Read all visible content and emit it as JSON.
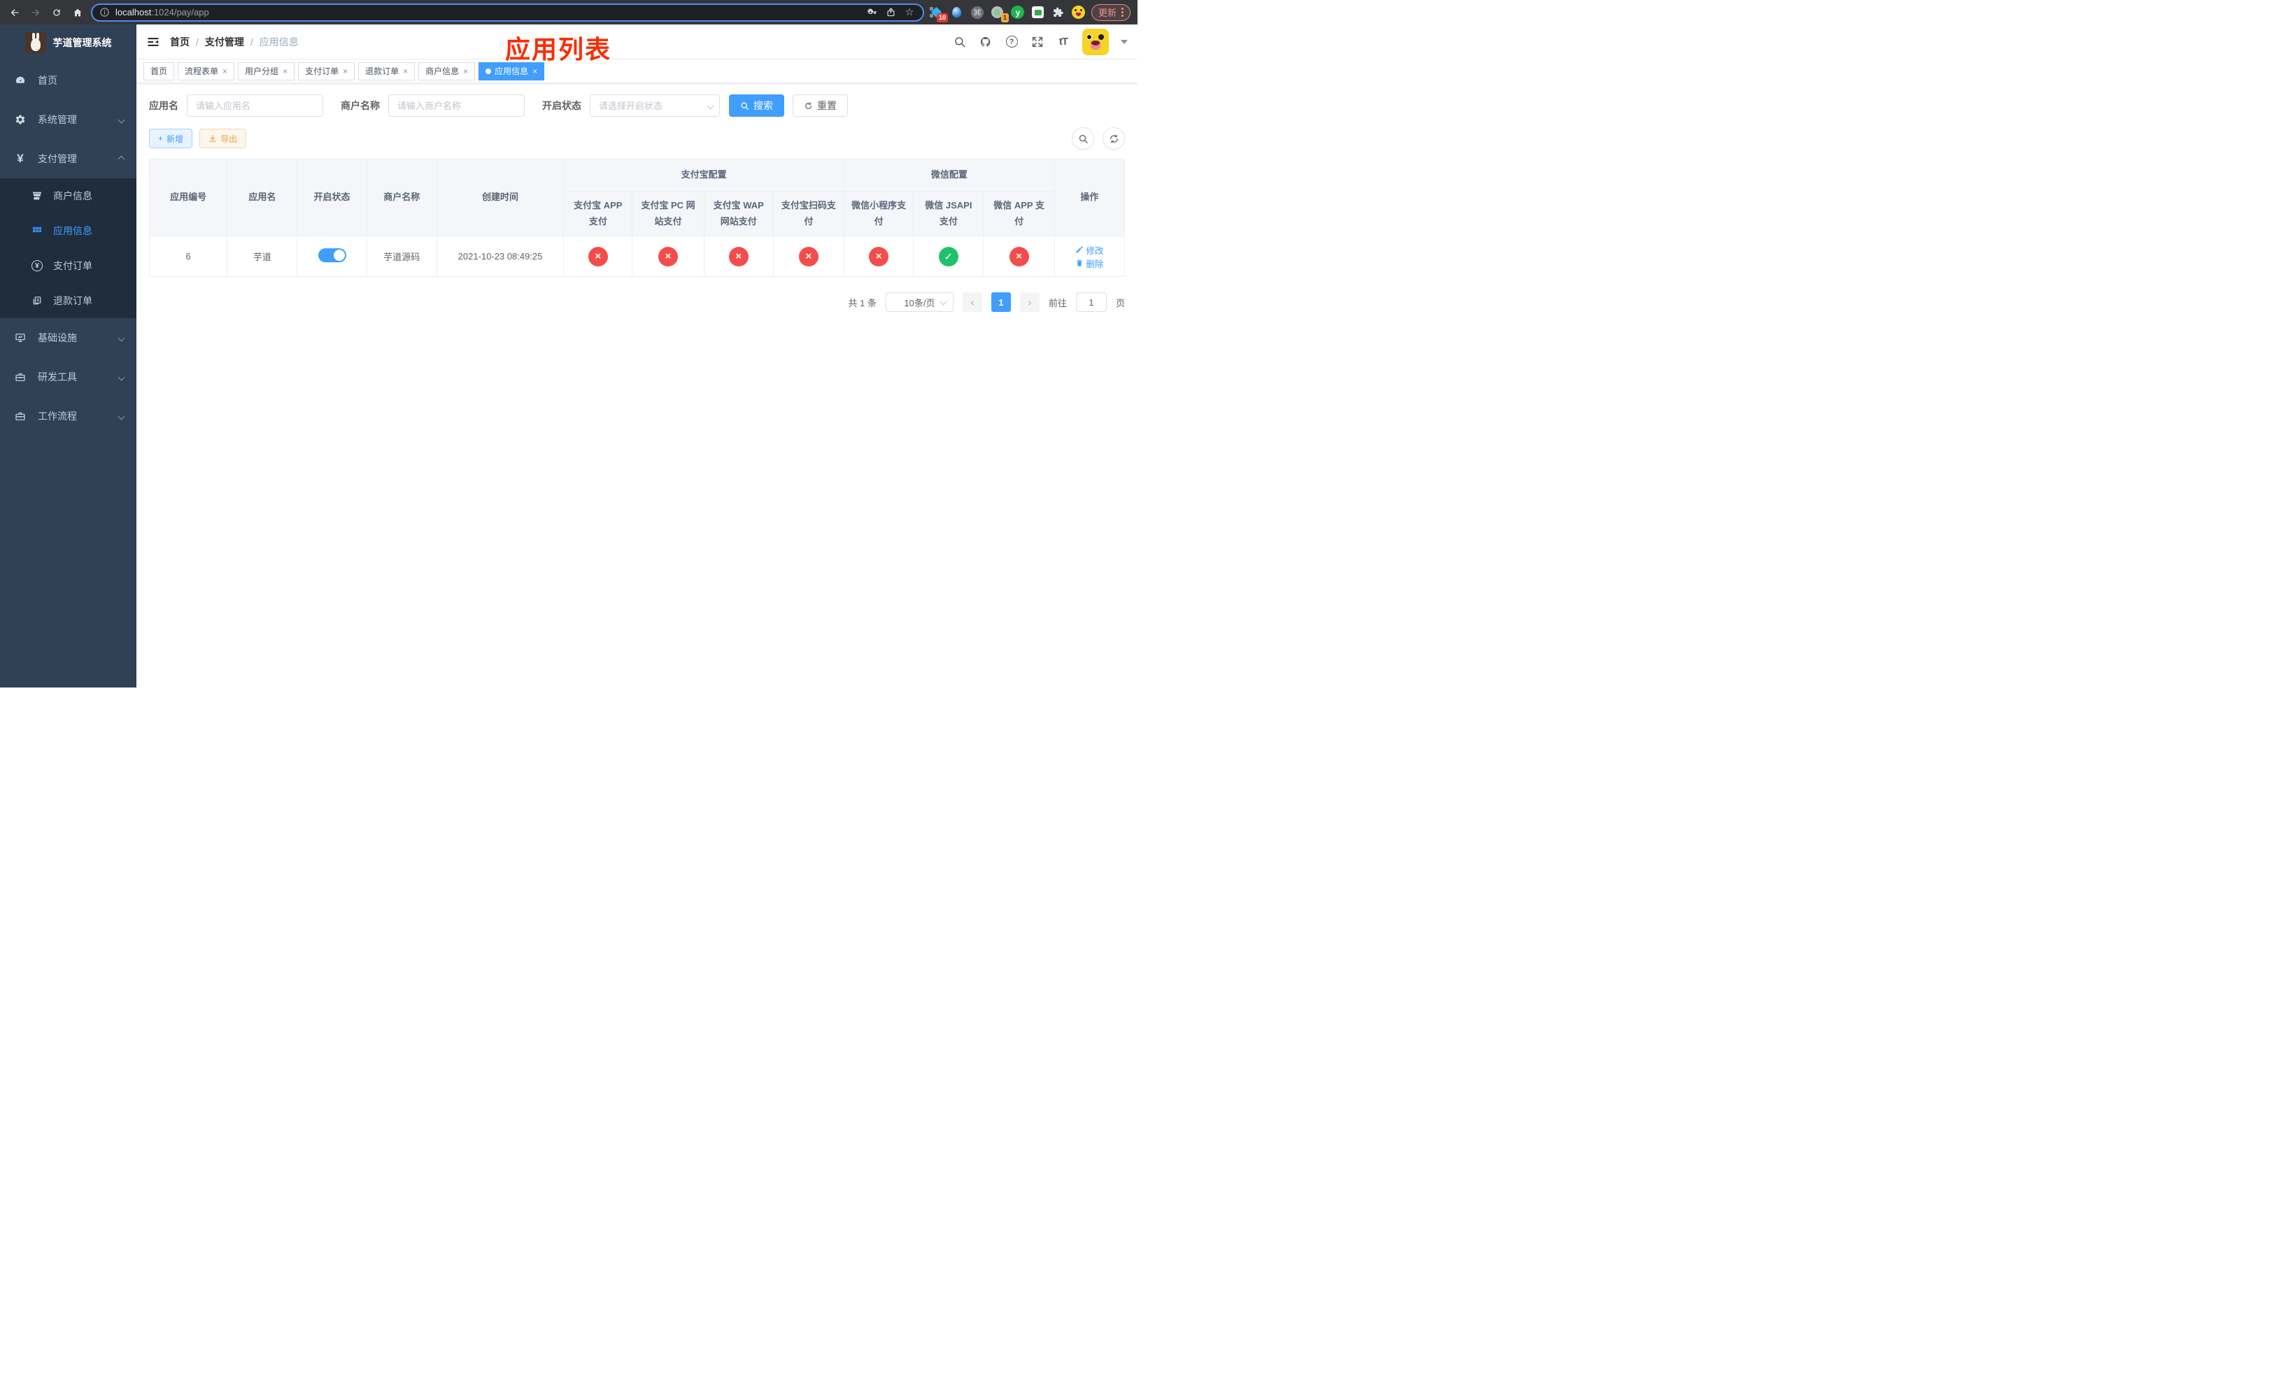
{
  "browser": {
    "url": {
      "host": "localhost",
      "rest": ":1024/pay/app"
    },
    "update_button": "更新",
    "extensions": {
      "diamond_badge": "10",
      "target_badge": "1",
      "y_label": "y"
    }
  },
  "glyphs": {
    "close": "×",
    "plus": "+",
    "star": "☆",
    "command": "⌘",
    "help": "?",
    "font_size": "tT",
    "yen": "¥",
    "prev": "‹",
    "next": "›"
  },
  "sidebar": {
    "title": "芋道管理系统",
    "menu": [
      {
        "label": "首页"
      },
      {
        "label": "系统管理"
      },
      {
        "label": "支付管理"
      }
    ],
    "submenu": [
      {
        "label": "商户信息"
      },
      {
        "label": "应用信息"
      },
      {
        "label": "支付订单"
      },
      {
        "label": "退款订单"
      }
    ],
    "menu2": [
      {
        "label": "基础设施"
      },
      {
        "label": "研发工具"
      },
      {
        "label": "工作流程"
      }
    ]
  },
  "navbar": {
    "breadcrumb": [
      "首页",
      "支付管理",
      "应用信息"
    ],
    "separator": "/"
  },
  "annotation": {
    "title": "应用列表"
  },
  "tabs": [
    {
      "label": "首页"
    },
    {
      "label": "流程表单"
    },
    {
      "label": "用户分组"
    },
    {
      "label": "支付订单"
    },
    {
      "label": "退款订单"
    },
    {
      "label": "商户信息"
    },
    {
      "label": "应用信息"
    }
  ],
  "filters": {
    "app_name_label": "应用名",
    "app_name_placeholder": "请输入应用名",
    "merchant_label": "商户名称",
    "merchant_placeholder": "请输入商户名称",
    "status_label": "开启状态",
    "status_placeholder": "请选择开启状态",
    "search_label": "搜索",
    "reset_label": "重置"
  },
  "toolbar": {
    "add_label": "新增",
    "export_label": "导出"
  },
  "table": {
    "headers": {
      "app_id": "应用编号",
      "app_name": "应用名",
      "status": "开启状态",
      "merchant": "商户名称",
      "created": "创建时间",
      "alipay_group": "支付宝配置",
      "wechat_group": "微信配置",
      "actions": "操作",
      "alipay_cols": [
        "支付宝 APP 支付",
        "支付宝 PC 网站支付",
        "支付宝 WAP 网站支付",
        "支付宝扫码支付"
      ],
      "wechat_cols": [
        "微信小程序支付",
        "微信 JSAPI 支付",
        "微信 APP 支付"
      ]
    },
    "row": {
      "app_id": "6",
      "app_name": "芋道",
      "enabled": true,
      "merchant": "芋道源码",
      "created": "2021-10-23 08:49:25",
      "statuses": [
        "fail",
        "fail",
        "fail",
        "fail",
        "fail",
        "pass",
        "fail"
      ],
      "edit_label": "修改",
      "delete_label": "删除"
    }
  },
  "pagination": {
    "total": "共 1 条",
    "page_size": "10条/页",
    "current_page": "1",
    "goto_label": "前往",
    "goto_value": "1",
    "page_unit": "页"
  },
  "colors": {
    "accent": "#409eff",
    "danger": "#f44c4b",
    "success": "#1fc16a",
    "sidebar_bg": "#304156",
    "submenu_bg": "#1f2d3d"
  }
}
